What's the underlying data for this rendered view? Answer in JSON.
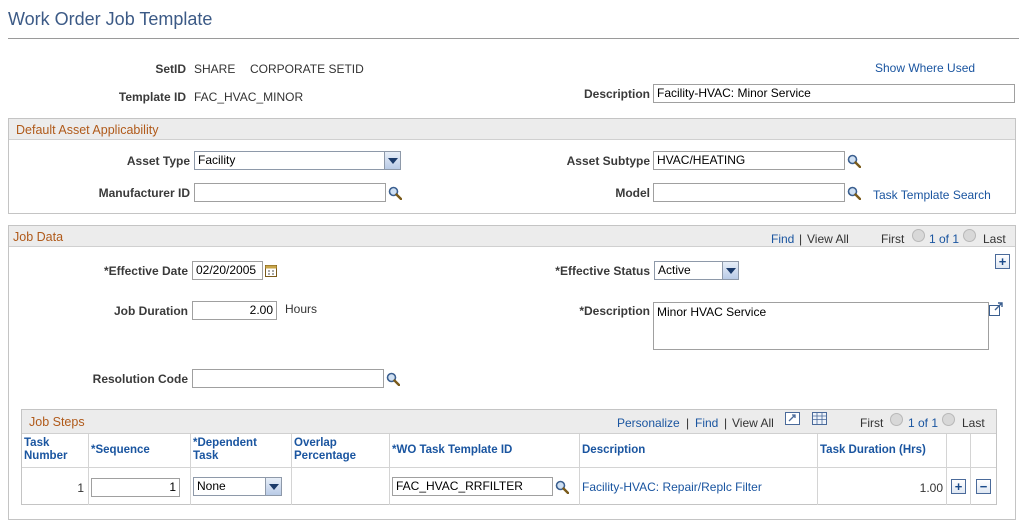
{
  "page": {
    "title": "Work Order Job Template"
  },
  "header": {
    "setid_label": "SetID",
    "setid_value": "SHARE",
    "setid_desc": "CORPORATE SETID",
    "template_label": "Template ID",
    "template_value": "FAC_HVAC_MINOR",
    "show_where_used": "Show Where Used",
    "description_label": "Description",
    "description_value": "Facility-HVAC: Minor Service"
  },
  "asset": {
    "title": "Default Asset Applicability",
    "asset_type_label": "Asset Type",
    "asset_type_value": "Facility",
    "asset_subtype_label": "Asset Subtype",
    "asset_subtype_value": "HVAC/HEATING",
    "manufacturer_label": "Manufacturer ID",
    "manufacturer_value": "",
    "model_label": "Model",
    "model_value": "",
    "task_template_search": "Task Template Search"
  },
  "job": {
    "title": "Job Data",
    "find": "Find",
    "sep": "|",
    "view_all": "View All",
    "first": "First",
    "range": "1 of 1",
    "last": "Last",
    "eff_date_label": "*Effective Date",
    "eff_date_value": "02/20/2005",
    "eff_status_label": "*Effective Status",
    "eff_status_value": "Active",
    "duration_label": "Job Duration",
    "duration_value": "2.00",
    "duration_unit": "Hours",
    "desc_label": "*Description",
    "desc_value": "Minor HVAC Service",
    "resolution_label": "Resolution Code",
    "resolution_value": ""
  },
  "steps": {
    "title": "Job Steps",
    "personalize": "Personalize",
    "find": "Find",
    "sep": "|",
    "view_all": "View All",
    "first": "First",
    "range": "1 of 1",
    "last": "Last",
    "columns": {
      "task_number": "Task Number",
      "sequence": "*Sequence",
      "dependent": "*Dependent Task",
      "overlap": "Overlap Percentage",
      "wo_task": "*WO Task Template ID",
      "description": "Description",
      "duration": "Task Duration (Hrs)"
    },
    "rows": [
      {
        "task_number": "1",
        "sequence": "1",
        "dependent": "None",
        "overlap": "",
        "wo_task": "FAC_HVAC_RRFILTER",
        "description": "Facility-HVAC: Repair/Replc Filter",
        "duration": "1.00"
      }
    ]
  },
  "icons": {
    "lookup": "magnifier-icon",
    "calendar": "calendar-icon",
    "expand": "expand-textarea-icon",
    "add": "plus-icon",
    "delete": "minus-icon",
    "zoom": "zoom-grid-icon",
    "download": "download-grid-icon"
  },
  "colors": {
    "title": "#3c5a86",
    "group_title": "#b05a1a",
    "link": "#1a55a0"
  }
}
